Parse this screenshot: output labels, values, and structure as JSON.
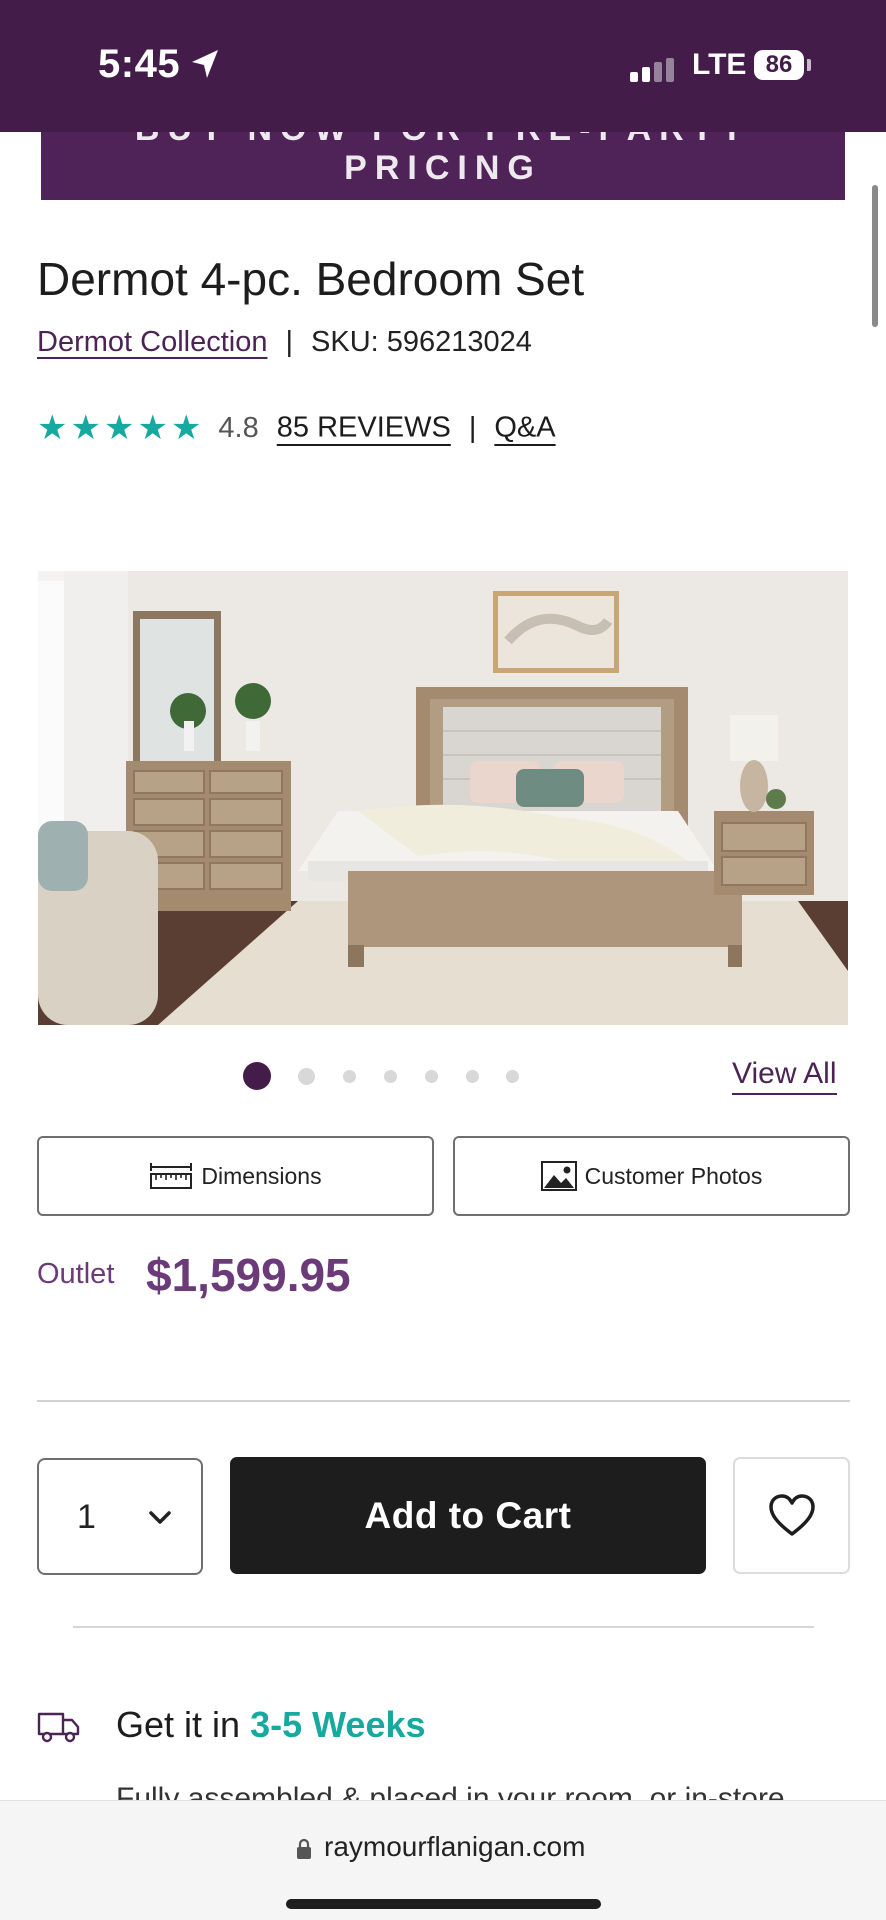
{
  "status_bar": {
    "time": "5:45",
    "network": "LTE",
    "battery": "86"
  },
  "promo": {
    "text": "BUY NOW FOR PRE-PARTY PRICING"
  },
  "product": {
    "title": "Dermot 4-pc. Bedroom Set",
    "collection": "Dermot Collection",
    "separator": "|",
    "sku": "SKU: 596213024",
    "rating": "4.8",
    "rating_stars": 4.8,
    "reviews_label": "85 REVIEWS",
    "qa_label": "Q&A"
  },
  "gallery": {
    "image_count": 7,
    "active_index": 0,
    "view_all_label": "View All"
  },
  "tools": {
    "dimensions_label": "Dimensions",
    "customer_photos_label": "Customer Photos"
  },
  "pricing": {
    "tag": "Outlet",
    "price": "$1,599.95"
  },
  "purchase": {
    "quantity": "1",
    "add_to_cart_label": "Add to Cart"
  },
  "delivery": {
    "prefix": "Get it in ",
    "weeks": "3-5 Weeks",
    "detail": "Fully assembled & placed in your room, or in-store"
  },
  "browser": {
    "url": "raymourflanigan.com"
  },
  "colors": {
    "brand_purple": "#431c49",
    "price_purple": "#6b3a78",
    "teal": "#17a9a0",
    "button_black": "#1d1d1d"
  }
}
